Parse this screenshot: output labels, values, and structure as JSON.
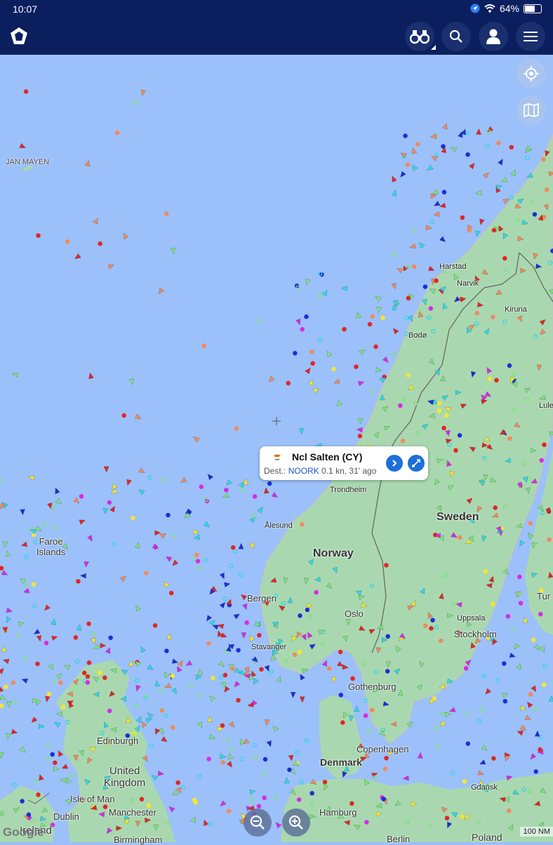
{
  "status_bar": {
    "time": "10:07",
    "battery": "64%"
  },
  "topbar": {
    "logo_icon": "marinetraffic-logo-icon",
    "binoculars_icon": "binoculars-icon",
    "search_icon": "search-icon",
    "account_icon": "user-icon",
    "menu_icon": "hamburger-menu-icon"
  },
  "map_controls": {
    "locate_icon": "locate-crosshair-icon",
    "layers_icon": "map-layers-icon"
  },
  "map_labels": {
    "jan_mayen": "JAN MAYEN",
    "harstad": "Harstad",
    "narvik": "Narvik",
    "kiruna": "Kiruna",
    "bodo": "Bodø",
    "lulea": "Lule",
    "trondheim": "Trondheim",
    "alesund": "Ålesund",
    "sweden": "Sweden",
    "norway": "Norway",
    "faroe_islands": "Faroe\nIslands",
    "bergen": "Bergen",
    "oslo": "Oslo",
    "turku": "Tur",
    "uppsala": "Uppsala",
    "stockholm": "Stockholm",
    "stavanger": "Stavanger",
    "gothenburg": "Gothenburg",
    "edinburgh": "Edinburgh",
    "copenhagen": "Copenhagen",
    "denmark": "Denmark",
    "united_kingdom": "United\nKingdom",
    "gdansk": "Gdańsk",
    "isle_of_man": "Isle of Man",
    "manchester": "Manchester",
    "hamburg": "Hamburg",
    "dublin": "Dublin",
    "ireland": "Ireland",
    "birmingham": "Birmingham",
    "berlin": "Berlin",
    "poland": "Poland"
  },
  "popup": {
    "flag": "CY",
    "vessel_name": "Ncl Salten (CY)",
    "dest_label": "Dest.:",
    "dest_code": "NOORK",
    "speed_age": "0.1 kn, 31' ago",
    "details_icon": "chevron-right-icon",
    "route_icon": "route-icon"
  },
  "zoom": {
    "zoom_out_icon": "zoom-out-icon",
    "zoom_in_icon": "zoom-in-icon"
  },
  "attribution": {
    "google": "Google"
  },
  "scale": {
    "text": "100 NM"
  },
  "colors": {
    "sea": "#9cc0f9",
    "land": "#a9d8b0",
    "topbar": "#0b1f5f",
    "vessel_cargo": "#7ee07e",
    "vessel_tanker": "#e02626",
    "vessel_passenger": "#1b2fd6",
    "vessel_fishing": "#f08a5d",
    "vessel_tug": "#33d6e6",
    "vessel_pleasure": "#d82ae6",
    "vessel_highspeed": "#f2e830"
  }
}
